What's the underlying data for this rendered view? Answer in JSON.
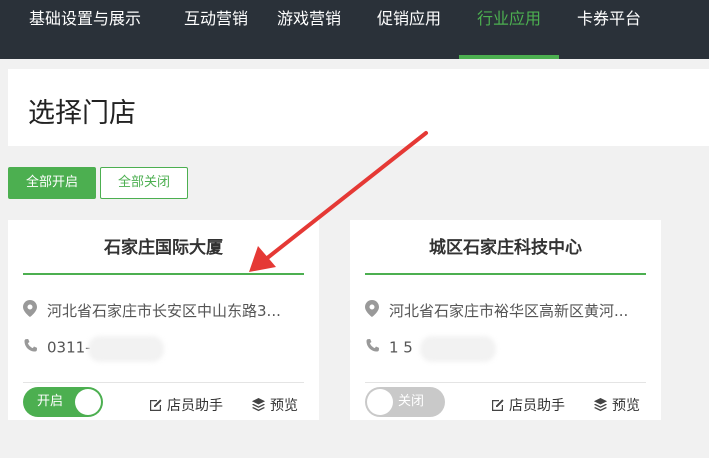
{
  "nav": {
    "items": [
      {
        "label": "基础设置与展示"
      },
      {
        "label": "互动营销"
      },
      {
        "label": "游戏营销"
      },
      {
        "label": "促销应用"
      },
      {
        "label": "行业应用",
        "active": true
      },
      {
        "label": "卡券平台"
      }
    ]
  },
  "page": {
    "title": "选择门店"
  },
  "actions": {
    "open_all": "全部开启",
    "close_all": "全部关闭"
  },
  "stores": [
    {
      "name": "石家庄国际大厦",
      "address": "河北省石家庄市长安区中山东路3...",
      "phone": "0311-          9999",
      "toggle": "开启",
      "toggle_on": true,
      "staff_label": "店员助手",
      "preview_label": "预览"
    },
    {
      "name": "城区石家庄科技中心",
      "address": "河北省石家庄市裕华区高新区黄河...",
      "phone": "1              5",
      "toggle": "关闭",
      "toggle_on": false,
      "staff_label": "店员助手",
      "preview_label": "预览"
    }
  ],
  "colors": {
    "accent": "#4caf50",
    "nav_bg": "#2a3139",
    "annotation_arrow": "#e53935"
  },
  "icons": [
    "location-icon",
    "phone-icon",
    "edit-icon",
    "layers-icon"
  ]
}
